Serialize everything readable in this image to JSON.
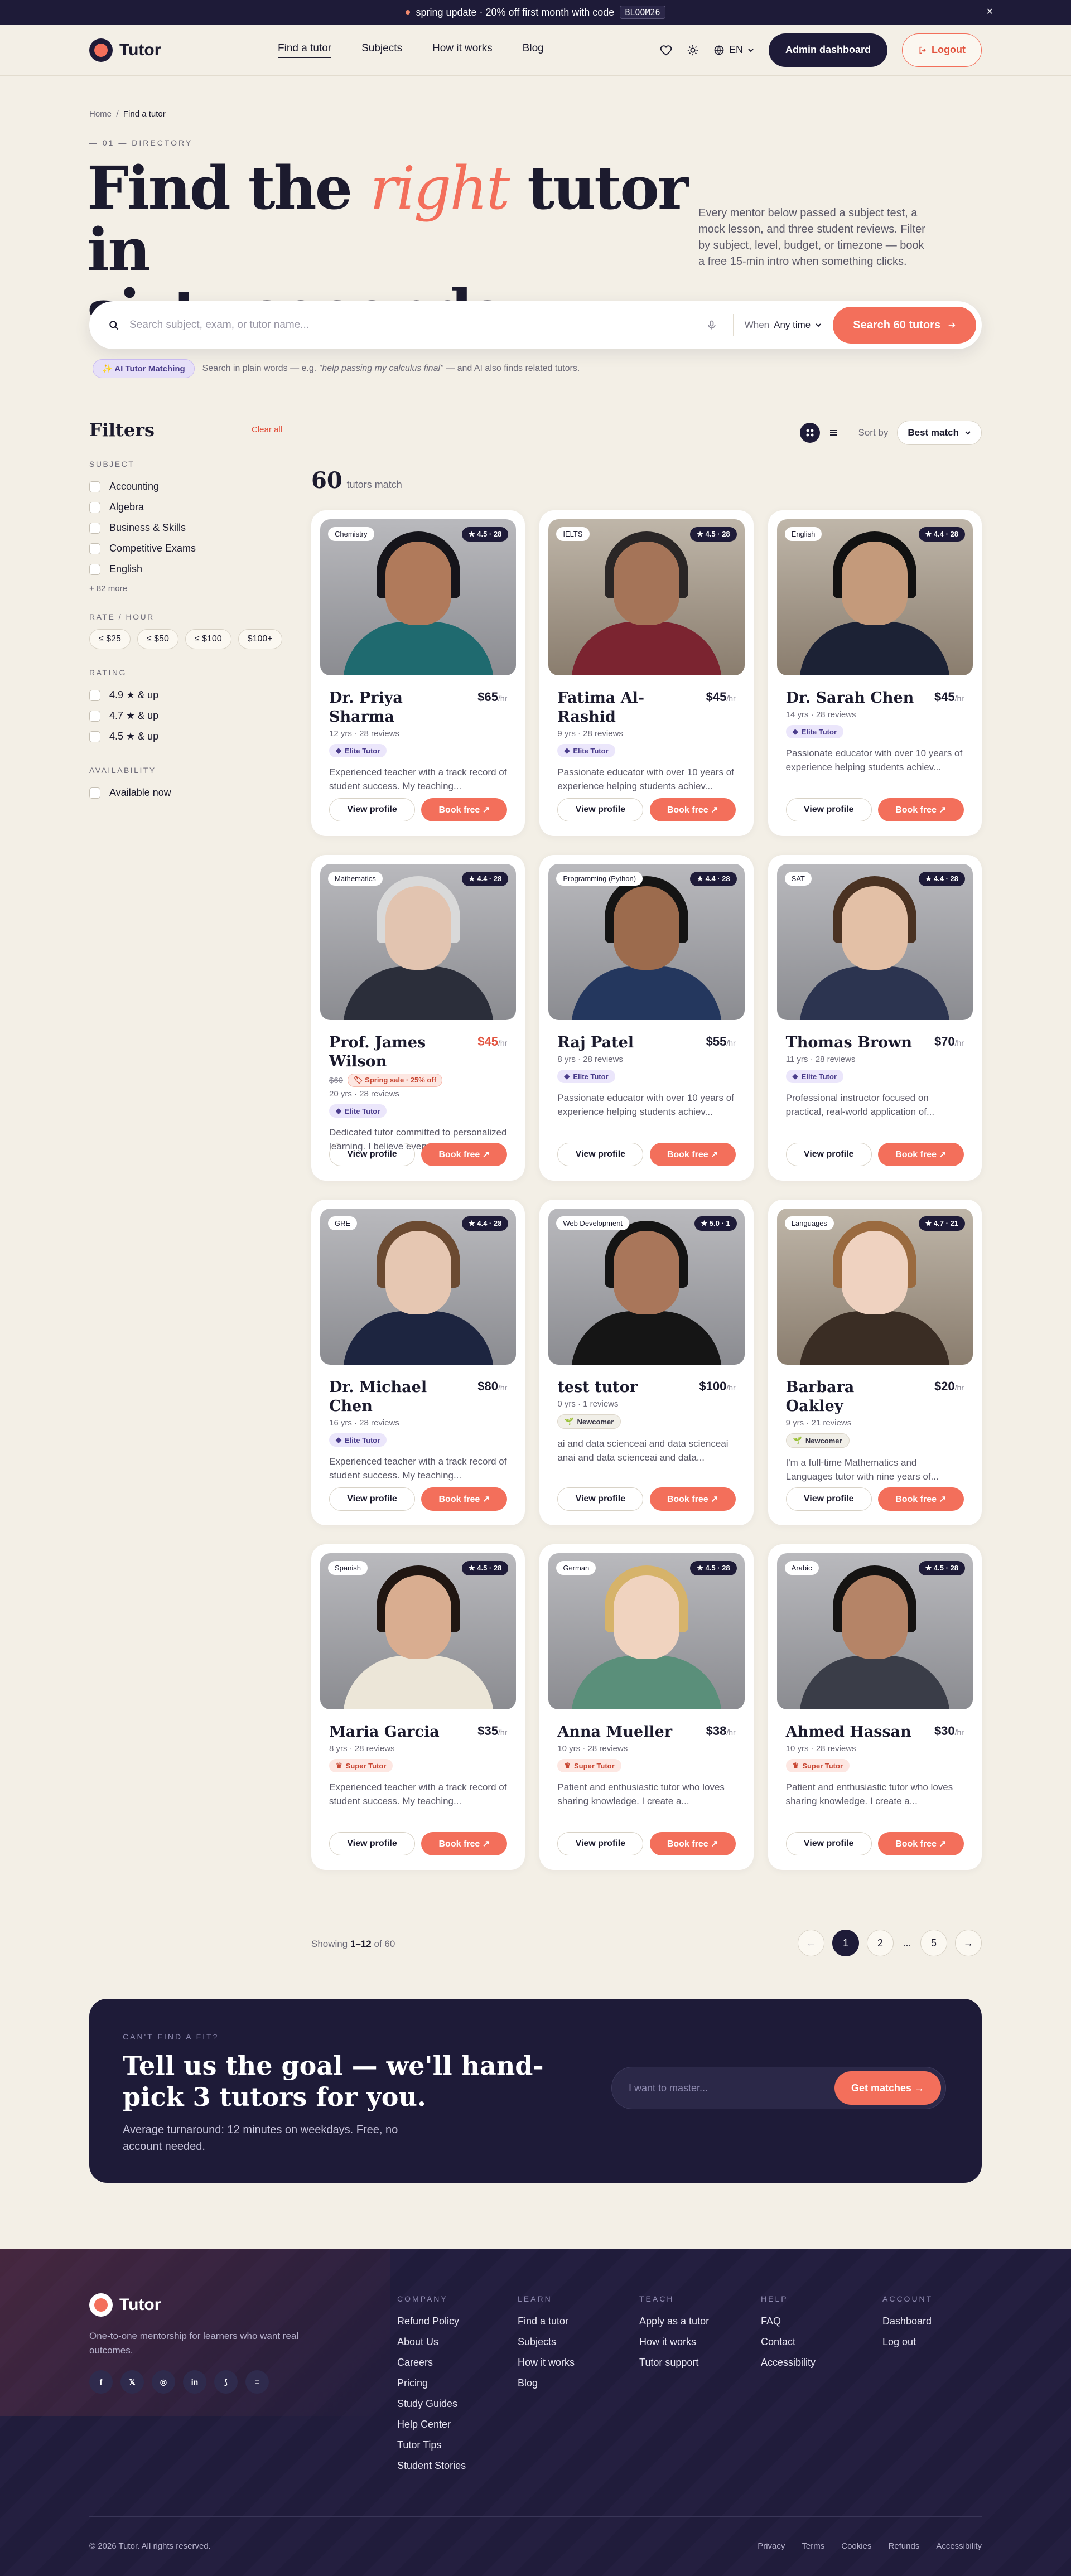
{
  "promo": {
    "text": "spring update · 20% off first month with code",
    "code": "BLOOM26",
    "close": "×"
  },
  "nav": {
    "brand": "Tutor",
    "links": [
      "Find a tutor",
      "Subjects",
      "How it works",
      "Blog"
    ],
    "lang": "EN",
    "admin": "Admin dashboard",
    "logout": "Logout"
  },
  "hero": {
    "breadcrumb": [
      "Home",
      "/",
      "Find a tutor"
    ],
    "eyebrow": "— 01 — DIRECTORY",
    "title_a": "Find the ",
    "title_accent": "right",
    "title_b": " tutor in",
    "title_c": "sixty seconds.",
    "desc": "Every mentor below passed a subject test, a mock lesson, and three student reviews. Filter by subject, level, budget, or timezone — book a free 15-min intro when something clicks."
  },
  "search": {
    "placeholder": "Search subject, exam, or tutor name...",
    "when_label": "When",
    "when_value": "Any time",
    "button": "Search 60 tutors"
  },
  "ai": {
    "pill": "AI Tutor Matching",
    "hint": "Search in plain words — e.g. ",
    "example": "\"help passing my calculus final\"",
    "tail": " — and AI also finds related tutors."
  },
  "filters": {
    "title": "Filters",
    "clear": "Clear all",
    "subject_label": "SUBJECT",
    "subjects": [
      "Accounting",
      "Algebra",
      "Business & Skills",
      "Competitive Exams",
      "English"
    ],
    "more": "+ 82 more",
    "rate_label": "RATE / HOUR",
    "rates": [
      "≤ $25",
      "≤ $50",
      "≤ $100",
      "$100+"
    ],
    "rating_label": "RATING",
    "ratings": [
      "4.9 ★ & up",
      "4.7 ★ & up",
      "4.5 ★ & up"
    ],
    "avail_label": "AVAILABILITY",
    "avail": "Available now"
  },
  "toolbar": {
    "sort_label": "Sort by",
    "sort_value": "Best match",
    "count": "60",
    "count_suffix": "tutors match"
  },
  "card_actions": {
    "view": "View profile",
    "book": "Book free ↗"
  },
  "tutors": [
    {
      "subject": "Chemistry",
      "rating": "★ 4.5 · 28",
      "name": "Dr. Priya Sharma",
      "price": "$65",
      "per": "/hr",
      "meta": "12 yrs · 28 reviews",
      "badge": "Elite Tutor",
      "bio": "Experienced teacher with a track record of student success. My teaching..."
    },
    {
      "subject": "IELTS",
      "rating": "★ 4.5 · 28",
      "name": "Fatima Al-Rashid",
      "price": "$45",
      "per": "/hr",
      "meta": "9 yrs · 28 reviews",
      "badge": "Elite Tutor",
      "bio": "Passionate educator with over 10 years of experience helping students achiev..."
    },
    {
      "subject": "English",
      "rating": "★ 4.4 · 28",
      "name": "Dr. Sarah Chen",
      "price": "$45",
      "per": "/hr",
      "meta": "14 yrs · 28 reviews",
      "badge": "Elite Tutor",
      "bio": "Passionate educator with over 10 years of experience helping students achiev..."
    },
    {
      "subject": "Mathematics",
      "rating": "★ 4.4 · 28",
      "name": "Prof. James Wilson",
      "price": "$45",
      "per": "/hr",
      "old_price": "$60",
      "sale": "Spring sale · 25% off",
      "meta": "20 yrs · 28 reviews",
      "badge": "Elite Tutor",
      "bio": "Dedicated tutor committed to personalized learning. I believe every..."
    },
    {
      "subject": "Programming (Python)",
      "rating": "★ 4.4 · 28",
      "name": "Raj Patel",
      "price": "$55",
      "per": "/hr",
      "meta": "8 yrs · 28 reviews",
      "badge": "Elite Tutor",
      "bio": "Passionate educator with over 10 years of experience helping students achiev..."
    },
    {
      "subject": "SAT",
      "rating": "★ 4.4 · 28",
      "name": "Thomas Brown",
      "price": "$70",
      "per": "/hr",
      "meta": "11 yrs · 28 reviews",
      "badge": "Elite Tutor",
      "bio": "Professional instructor focused on practical, real-world application of..."
    },
    {
      "subject": "GRE",
      "rating": "★ 4.4 · 28",
      "name": "Dr. Michael Chen",
      "price": "$80",
      "per": "/hr",
      "meta": "16 yrs · 28 reviews",
      "badge": "Elite Tutor",
      "bio": "Experienced teacher with a track record of student success. My teaching..."
    },
    {
      "subject": "Web Development",
      "rating": "★ 5.0 · 1",
      "name": "test tutor",
      "price": "$100",
      "per": "/hr",
      "meta": "0 yrs · 1 reviews",
      "badge": "Newcomer",
      "bio": "ai and data scienceai and data scienceai anai and data scienceai and data..."
    },
    {
      "subject": "Languages",
      "rating": "★ 4.7 · 21",
      "name": "Barbara Oakley",
      "price": "$20",
      "per": "/hr",
      "meta": "9 yrs · 21 reviews",
      "badge": "Newcomer",
      "bio": "I'm a full-time Mathematics and Languages tutor with nine years of..."
    },
    {
      "subject": "Spanish",
      "rating": "★ 4.5 · 28",
      "name": "Maria Garcia",
      "price": "$35",
      "per": "/hr",
      "meta": "8 yrs · 28 reviews",
      "badge": "Super Tutor",
      "bio": "Experienced teacher with a track record of student success. My teaching..."
    },
    {
      "subject": "German",
      "rating": "★ 4.5 · 28",
      "name": "Anna Mueller",
      "price": "$38",
      "per": "/hr",
      "meta": "10 yrs · 28 reviews",
      "badge": "Super Tutor",
      "bio": "Patient and enthusiastic tutor who loves sharing knowledge. I create a..."
    },
    {
      "subject": "Arabic",
      "rating": "★ 4.5 · 28",
      "name": "Ahmed Hassan",
      "price": "$30",
      "per": "/hr",
      "meta": "10 yrs · 28 reviews",
      "badge": "Super Tutor",
      "bio": "Patient and enthusiastic tutor who loves sharing knowledge. I create a..."
    }
  ],
  "pagination": {
    "showing_a": "Showing ",
    "showing_range": "1–12",
    "showing_b": " of 60",
    "prev": "←",
    "pages": [
      "1",
      "2",
      "...",
      "5"
    ],
    "next": "→"
  },
  "cta": {
    "eyebrow": "CAN'T FIND A FIT?",
    "title": "Tell us the goal — we'll hand-pick 3 tutors for you.",
    "desc": "Average turnaround: 12 minutes on weekdays. Free, no account needed.",
    "placeholder": "I want to master...",
    "button": "Get matches →"
  },
  "footer": {
    "brand": "Tutor",
    "tagline": "One-to-one mentorship for learners who want real outcomes.",
    "columns": [
      {
        "title": "COMPANY",
        "links": [
          "Refund Policy",
          "About Us",
          "Careers",
          "Pricing",
          "Study Guides",
          "Help Center",
          "Tutor Tips",
          "Student Stories"
        ]
      },
      {
        "title": "LEARN",
        "links": [
          "Find a tutor",
          "Subjects",
          "How it works",
          "Blog"
        ]
      },
      {
        "title": "TEACH",
        "links": [
          "Apply as a tutor",
          "How it works",
          "Tutor support"
        ]
      },
      {
        "title": "HELP",
        "links": [
          "FAQ",
          "Contact",
          "Accessibility"
        ]
      },
      {
        "title": "ACCOUNT",
        "links": [
          "Dashboard",
          "Log out"
        ]
      }
    ],
    "copyright": "© 2026 Tutor. All rights reserved.",
    "legal": [
      "Privacy",
      "Terms",
      "Cookies",
      "Refunds",
      "Accessibility"
    ]
  },
  "colors": {
    "accent": "#f36f5b",
    "navy": "#1e1b38",
    "cream": "#f3efe6"
  }
}
